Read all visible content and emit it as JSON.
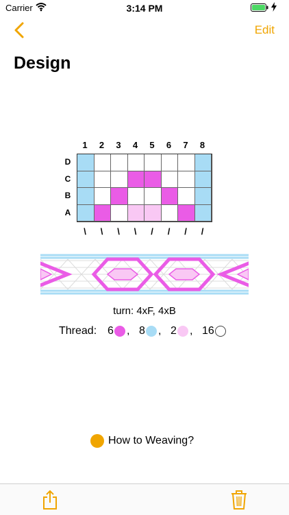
{
  "status_bar": {
    "carrier": "Carrier",
    "time": "3:14 PM"
  },
  "nav": {
    "back_icon": "chevron-left-icon",
    "edit_label": "Edit"
  },
  "title": "Design",
  "grid": {
    "column_numbers": [
      "1",
      "2",
      "3",
      "4",
      "5",
      "6",
      "7",
      "8"
    ],
    "row_labels": [
      "D",
      "C",
      "B",
      "A"
    ],
    "turn_marks": [
      "\\",
      "\\",
      "\\",
      "\\",
      "/",
      "/",
      "/",
      "/"
    ],
    "colors": {
      "B": "#a8dcf5",
      "P": "#ea5ce6",
      "L": "#f9c8f4",
      "W": "#ffffff"
    },
    "cells": [
      [
        "B",
        "W",
        "W",
        "W",
        "W",
        "W",
        "W",
        "B"
      ],
      [
        "B",
        "W",
        "W",
        "P",
        "P",
        "W",
        "W",
        "B"
      ],
      [
        "B",
        "W",
        "P",
        "W",
        "W",
        "P",
        "W",
        "B"
      ],
      [
        "B",
        "P",
        "W",
        "L",
        "L",
        "W",
        "P",
        "B"
      ]
    ]
  },
  "turn_text": "turn: 4xF, 4xB",
  "thread": {
    "label": "Thread:",
    "items": [
      {
        "count": "6",
        "color": "#ea5ce6",
        "sep": ","
      },
      {
        "count": "8",
        "color": "#a8dcf5",
        "sep": ","
      },
      {
        "count": "2",
        "color": "#f9c8f4",
        "sep": ","
      },
      {
        "count": "16",
        "color": "#ffffff",
        "sep": ""
      }
    ]
  },
  "howto_label": "How to Weaving?",
  "toolbar": {
    "share_icon": "share-icon",
    "trash_icon": "trash-icon"
  },
  "accent_color": "#f0a500"
}
